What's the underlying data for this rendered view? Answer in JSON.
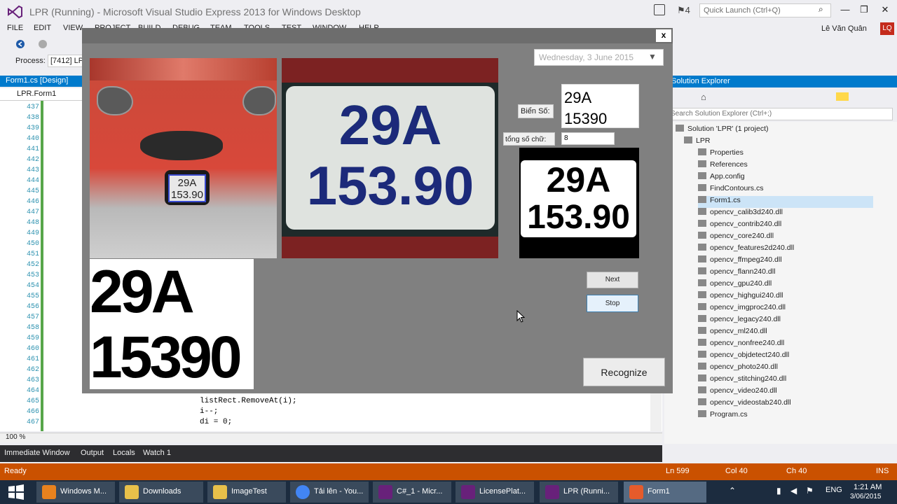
{
  "vs": {
    "title": "LPR (Running) - Microsoft Visual Studio Express 2013 for Windows Desktop",
    "notifications": "4",
    "quick_launch_placeholder": "Quick Launch (Ctrl+Q)",
    "user_name": "Lê Văn Quân",
    "user_initials": "LQ",
    "menu": [
      "FILE",
      "EDIT",
      "VIEW",
      "PROJECT",
      "BUILD",
      "DEBUG",
      "TEAM",
      "TOOLS",
      "TEST",
      "WINDOW",
      "HELP"
    ],
    "process_label": "Process:",
    "process_value": "[7412] LP"
  },
  "editor": {
    "tab_label": "Form1.cs [Design]",
    "nav_value": "LPR.Form1",
    "line_numbers": [
      "437",
      "438",
      "439",
      "440",
      "441",
      "442",
      "443",
      "444",
      "445",
      "446",
      "447",
      "448",
      "449",
      "450",
      "451",
      "452",
      "453",
      "454",
      "455",
      "456",
      "457",
      "458",
      "459",
      "460",
      "461",
      "462",
      "463",
      "464",
      "465",
      "466",
      "467"
    ],
    "code_lines": [
      "listRect.RemoveAt(i);",
      "i--;",
      "di = 0;"
    ],
    "zoom": "100 %"
  },
  "bottom_tabs": [
    "Immediate Window",
    "Output",
    "Locals",
    "Watch 1"
  ],
  "solution_explorer": {
    "title": "Solution Explorer",
    "search_placeholder": "Search Solution Explorer (Ctrl+;)",
    "items": [
      {
        "label": "Solution 'LPR' (1 project)",
        "level": 0
      },
      {
        "label": "LPR",
        "level": 1
      },
      {
        "label": "Properties",
        "level": 2
      },
      {
        "label": "References",
        "level": 2
      },
      {
        "label": "App.config",
        "level": 2
      },
      {
        "label": "FindContours.cs",
        "level": 2
      },
      {
        "label": "Form1.cs",
        "level": 2
      },
      {
        "label": "opencv_calib3d240.dll",
        "level": 2
      },
      {
        "label": "opencv_contrib240.dll",
        "level": 2
      },
      {
        "label": "opencv_core240.dll",
        "level": 2
      },
      {
        "label": "opencv_features2d240.dll",
        "level": 2
      },
      {
        "label": "opencv_ffmpeg240.dll",
        "level": 2
      },
      {
        "label": "opencv_flann240.dll",
        "level": 2
      },
      {
        "label": "opencv_gpu240.dll",
        "level": 2
      },
      {
        "label": "opencv_highgui240.dll",
        "level": 2
      },
      {
        "label": "opencv_imgproc240.dll",
        "level": 2
      },
      {
        "label": "opencv_legacy240.dll",
        "level": 2
      },
      {
        "label": "opencv_ml240.dll",
        "level": 2
      },
      {
        "label": "opencv_nonfree240.dll",
        "level": 2
      },
      {
        "label": "opencv_objdetect240.dll",
        "level": 2
      },
      {
        "label": "opencv_photo240.dll",
        "level": 2
      },
      {
        "label": "opencv_stitching240.dll",
        "level": 2
      },
      {
        "label": "opencv_video240.dll",
        "level": 2
      },
      {
        "label": "opencv_videostab240.dll",
        "level": 2
      },
      {
        "label": "Program.cs",
        "level": 2
      }
    ]
  },
  "status": {
    "state": "Ready",
    "ln": "Ln 599",
    "col": "Col 40",
    "ch": "Ch 40",
    "mode": "INS"
  },
  "taskbar": {
    "items": [
      "Windows M...",
      "Downloads",
      "ImageTest",
      "Tải lên - You...",
      "C#_1 - Micr...",
      "LicensePlat...",
      "LPR (Runni...",
      "Form1"
    ],
    "lang": "ENG",
    "time": "1:21 AM",
    "date": "3/06/2015"
  },
  "form": {
    "date": "Wednesday, 3 June 2015",
    "plate_label": "Biển Số:",
    "plate_line1": "29A",
    "plate_line2": "15390",
    "count_label": "tổng số chữ:",
    "count_value": "8",
    "plate_small_top": "29A",
    "plate_small_bottom": "153.90",
    "plate_big_top": "29A",
    "plate_big_bottom": "153.90",
    "bin_top": "29A",
    "bin_bottom": "153.90",
    "seg_top": "29A",
    "seg_bottom": "15390",
    "next_label": "Next",
    "stop_label": "Stop",
    "recognize_label": "Recognize"
  }
}
